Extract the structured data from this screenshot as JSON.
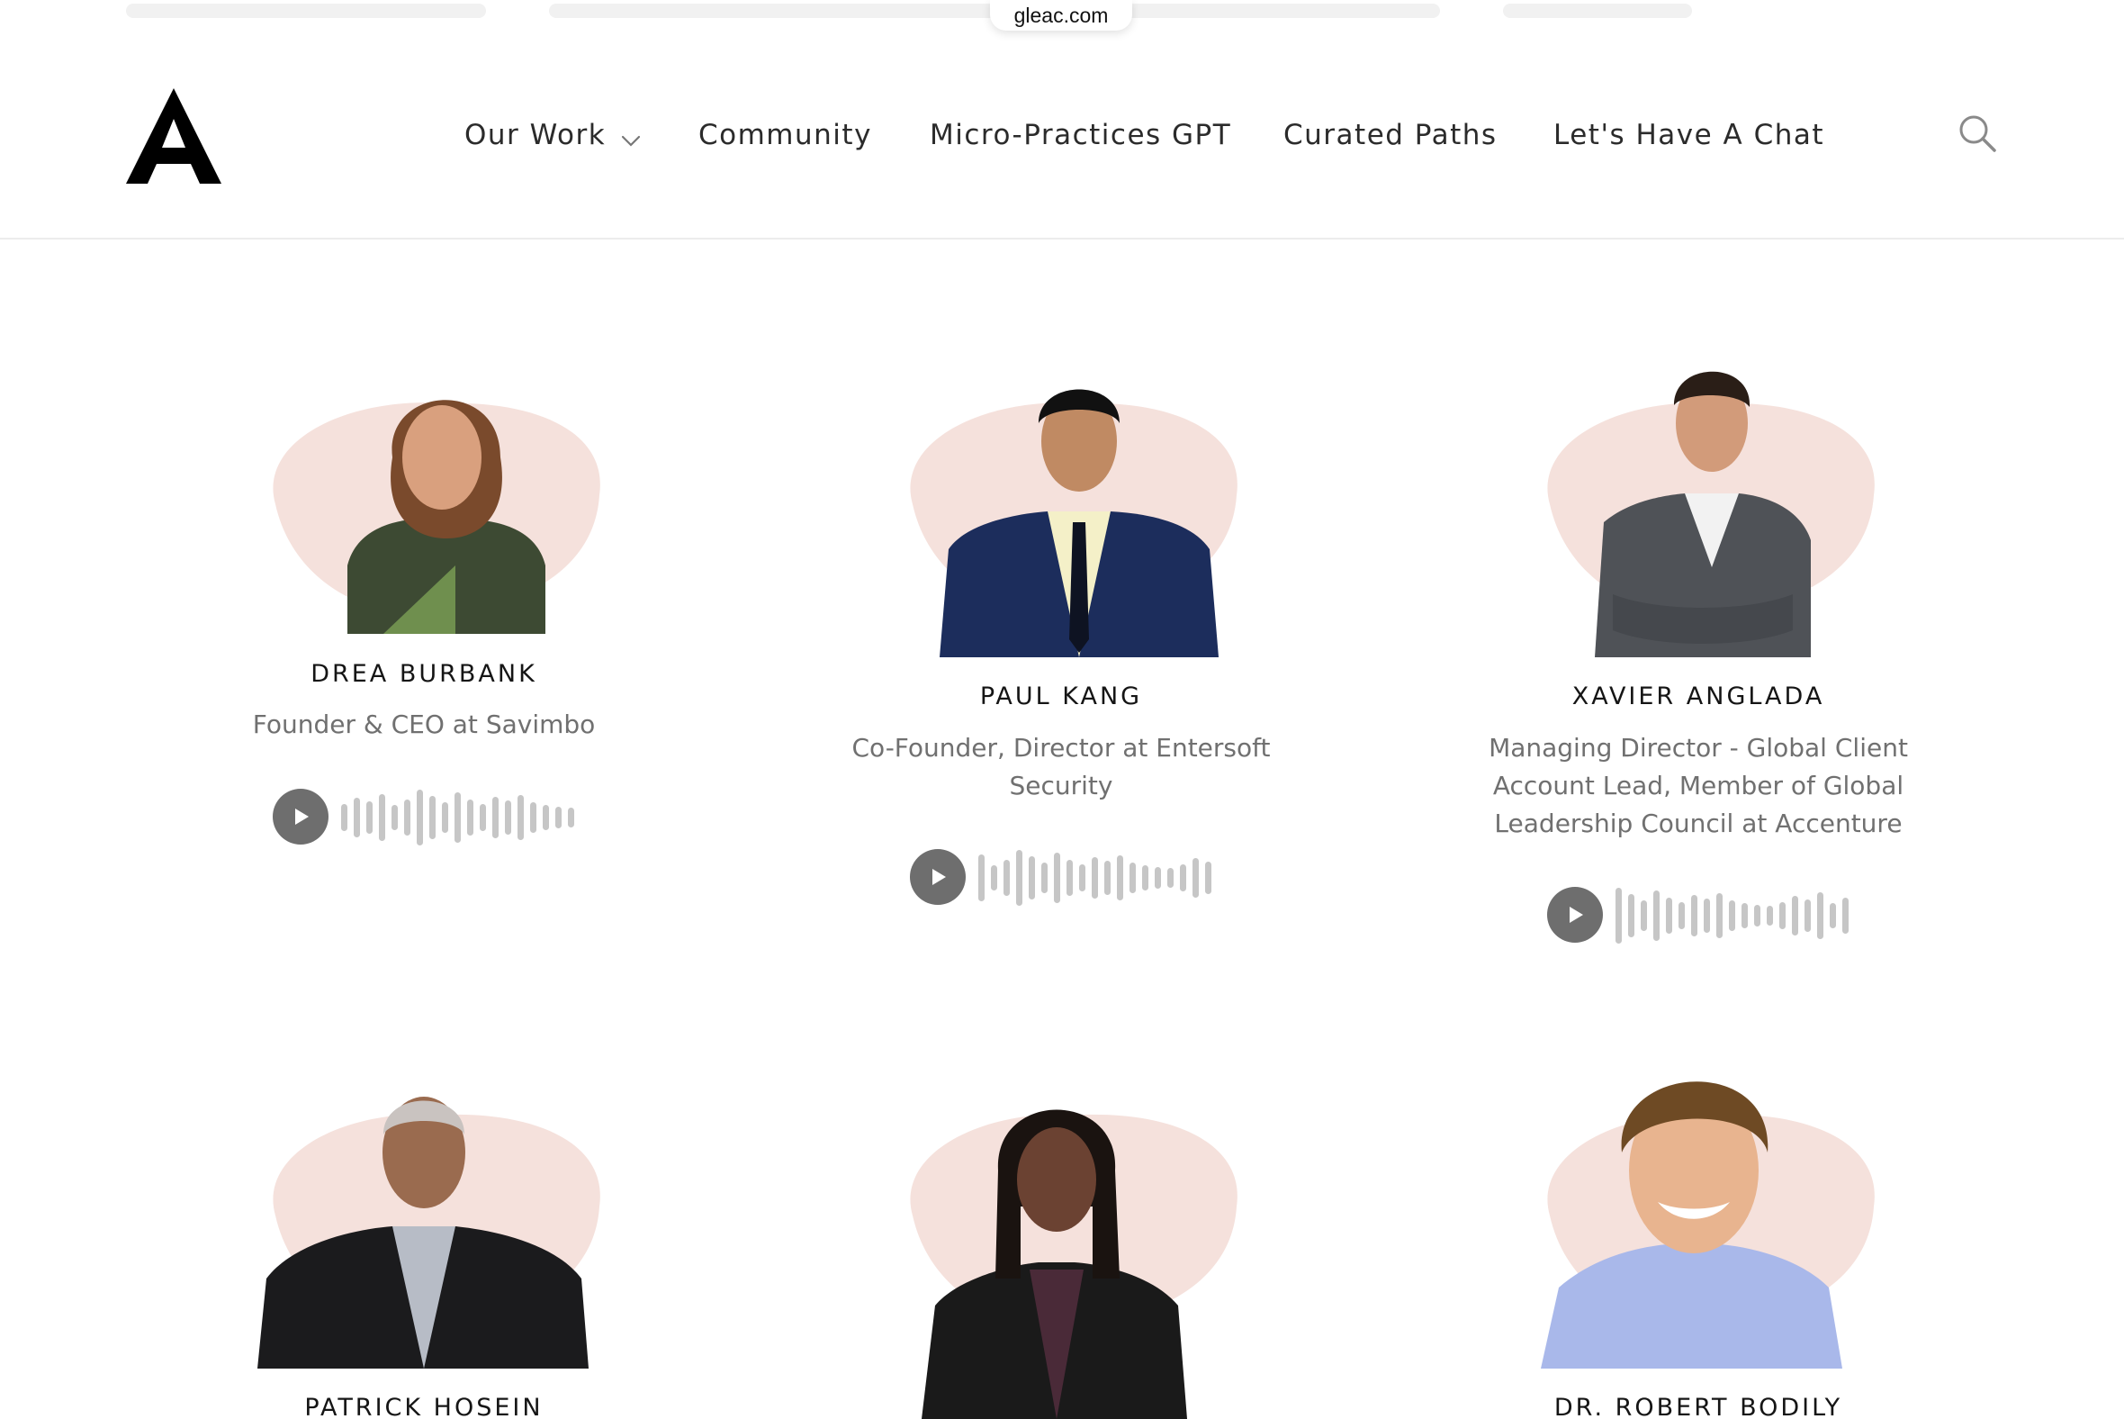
{
  "browser": {
    "url": "gleac.com"
  },
  "header": {
    "logo_alt": "A",
    "nav": [
      {
        "label": "Our Work",
        "has_dropdown": true
      },
      {
        "label": "Community"
      },
      {
        "label": "Micro-Practices GPT"
      },
      {
        "label": "Curated Paths"
      },
      {
        "label": "Let's Have A Chat"
      }
    ],
    "search_icon": "search-icon"
  },
  "colors": {
    "blob": "#f3dcd6",
    "play": "#6e6e6e",
    "wave": "#c6c6c6",
    "name": "#151515",
    "role": "#707070"
  },
  "people": [
    {
      "name": "DREA BURBANK",
      "role": "Founder & CEO at Savimbo"
    },
    {
      "name": "PAUL KANG",
      "role": "Co-Founder, Director at Entersoft Security"
    },
    {
      "name": "XAVIER ANGLADA",
      "role": "Managing Director - Global Client Account Lead, Member of Global Leadership Council at Accenture"
    },
    {
      "name": "PATRICK HOSEIN",
      "role": ""
    },
    {
      "name": "",
      "role": ""
    },
    {
      "name": "DR. ROBERT BODILY",
      "role": ""
    }
  ]
}
